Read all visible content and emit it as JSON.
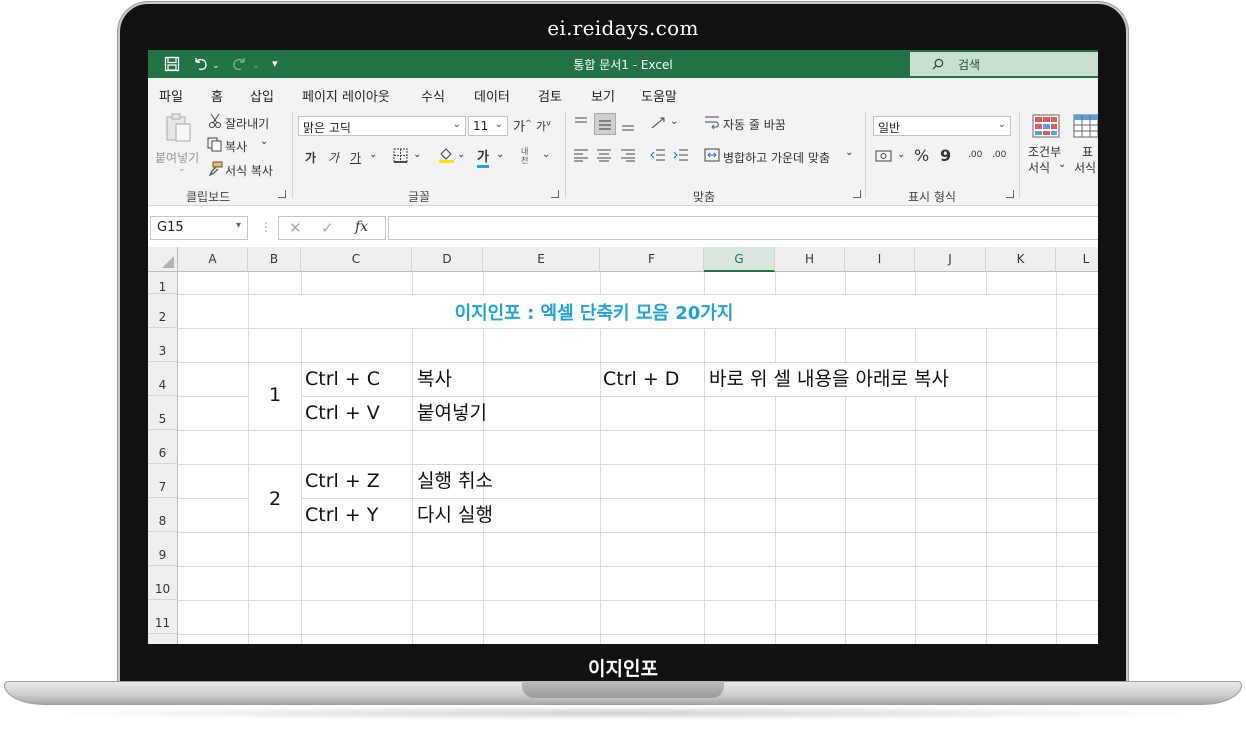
{
  "frame": {
    "top_caption": "ei.reidays.com",
    "bottom_caption": "이지인포"
  },
  "titlebar": {
    "title": "통합 문서1  -  Excel",
    "search_placeholder": "검색",
    "accent": "#217346"
  },
  "tabs": [
    "파일",
    "홈",
    "삽입",
    "페이지 레이아웃",
    "수식",
    "데이터",
    "검토",
    "보기",
    "도움말"
  ],
  "ribbon": {
    "clipboard": {
      "paste": "붙여넣기",
      "cut": "잘라내기",
      "copy": "복사",
      "format_painter": "서식 복사",
      "label": "클립보드"
    },
    "font": {
      "font_name": "맑은 고딕",
      "font_size": "11",
      "bold": "가",
      "italic": "가",
      "underline": "가",
      "font_color": "가",
      "phonetic": "내천",
      "label": "글꼴"
    },
    "alignment": {
      "wrap_text": "자동 줄 바꿈",
      "merge_center": "병합하고 가운데 맞춤",
      "label": "맞춤"
    },
    "number": {
      "format": "일반",
      "percent": "%",
      "comma": "9",
      "inc_decimal": ".00",
      "dec_decimal": ".00",
      "label": "표시 형식"
    },
    "styles": {
      "conditional_1": "조건부",
      "conditional_2": "서식",
      "table_1": "표",
      "table_2": "서식"
    }
  },
  "formula_bar": {
    "name_box": "G15",
    "fx": "fx",
    "content": ""
  },
  "sheet": {
    "columns": [
      "A",
      "B",
      "C",
      "D",
      "E",
      "F",
      "G",
      "H",
      "I",
      "J",
      "K",
      "L"
    ],
    "selected_column": "G",
    "rows": [
      "1",
      "2",
      "3",
      "4",
      "5",
      "6",
      "7",
      "8",
      "9",
      "10",
      "11"
    ],
    "title": "이지인포 : 엑셀 단축키 모음 20가지",
    "title_color": "#1ea3db",
    "group1_number": "1",
    "group2_number": "2",
    "r4_key": "Ctrl + C",
    "r4_desc": "복사",
    "r4_key2": "Ctrl + D",
    "r4_desc2": "바로 위 셀 내용을 아래로 복사",
    "r5_key": "Ctrl + V",
    "r5_desc": "붙여넣기",
    "r7_key": "Ctrl + Z",
    "r7_desc": "실행 취소",
    "r8_key": "Ctrl + Y",
    "r8_desc": "다시 실행"
  }
}
